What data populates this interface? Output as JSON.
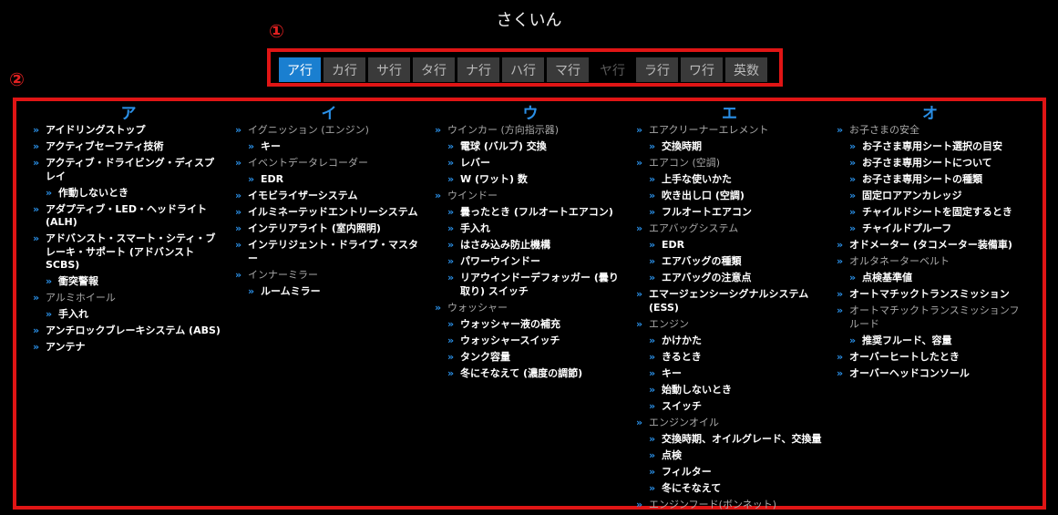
{
  "title": "さくいん",
  "markers": {
    "m1": "①",
    "m2": "②"
  },
  "colors": {
    "accent": "#1a7fd0",
    "frame": "#e01515",
    "heading": "#2a8fe6"
  },
  "tabs": [
    {
      "label": "ア行",
      "state": "active"
    },
    {
      "label": "カ行",
      "state": "normal"
    },
    {
      "label": "サ行",
      "state": "normal"
    },
    {
      "label": "タ行",
      "state": "normal"
    },
    {
      "label": "ナ行",
      "state": "normal"
    },
    {
      "label": "ハ行",
      "state": "normal"
    },
    {
      "label": "マ行",
      "state": "normal"
    },
    {
      "label": "ヤ行",
      "state": "disabled"
    },
    {
      "label": "ラ行",
      "state": "normal"
    },
    {
      "label": "ワ行",
      "state": "normal"
    },
    {
      "label": "英数",
      "state": "normal"
    }
  ],
  "columns": [
    {
      "heading": "ア",
      "entries": [
        {
          "text": "アイドリングストップ",
          "level": 0,
          "type": "link"
        },
        {
          "text": "アクティブセーフティ技術",
          "level": 0,
          "type": "link"
        },
        {
          "text": "アクティブ・ドライビング・ディスプレイ",
          "level": 0,
          "type": "link"
        },
        {
          "text": "作動しないとき",
          "level": 1,
          "type": "link"
        },
        {
          "text": "アダプティブ・LED・ヘッドライト (ALH)",
          "level": 0,
          "type": "link"
        },
        {
          "text": "アドバンスト・スマート・シティ・ブレーキ・サポート (アドバンストSCBS)",
          "level": 0,
          "type": "link"
        },
        {
          "text": "衝突警報",
          "level": 1,
          "type": "link"
        },
        {
          "text": "アルミホイール",
          "level": 0,
          "type": "cat"
        },
        {
          "text": "手入れ",
          "level": 1,
          "type": "link"
        },
        {
          "text": "アンチロックブレーキシステム (ABS)",
          "level": 0,
          "type": "link"
        },
        {
          "text": "アンテナ",
          "level": 0,
          "type": "link"
        }
      ]
    },
    {
      "heading": "イ",
      "entries": [
        {
          "text": "イグニッション (エンジン)",
          "level": 0,
          "type": "cat"
        },
        {
          "text": "キー",
          "level": 1,
          "type": "link"
        },
        {
          "text": "イベントデータレコーダー",
          "level": 0,
          "type": "cat"
        },
        {
          "text": "EDR",
          "level": 1,
          "type": "link"
        },
        {
          "text": "イモビライザーシステム",
          "level": 0,
          "type": "link"
        },
        {
          "text": "イルミネーテッドエントリーシステム",
          "level": 0,
          "type": "link"
        },
        {
          "text": "インテリアライト (室内照明)",
          "level": 0,
          "type": "link"
        },
        {
          "text": "インテリジェント・ドライブ・マスター",
          "level": 0,
          "type": "link"
        },
        {
          "text": "インナーミラー",
          "level": 0,
          "type": "cat"
        },
        {
          "text": "ルームミラー",
          "level": 1,
          "type": "link"
        }
      ]
    },
    {
      "heading": "ウ",
      "entries": [
        {
          "text": "ウインカー (方向指示器)",
          "level": 0,
          "type": "cat"
        },
        {
          "text": "電球 (バルブ) 交換",
          "level": 1,
          "type": "link"
        },
        {
          "text": "レバー",
          "level": 1,
          "type": "link"
        },
        {
          "text": "W (ワット) 数",
          "level": 1,
          "type": "link"
        },
        {
          "text": "ウインドー",
          "level": 0,
          "type": "cat"
        },
        {
          "text": "曇ったとき (フルオートエアコン)",
          "level": 1,
          "type": "link"
        },
        {
          "text": "手入れ",
          "level": 1,
          "type": "link"
        },
        {
          "text": "はさみ込み防止機構",
          "level": 1,
          "type": "link"
        },
        {
          "text": "パワーウインドー",
          "level": 1,
          "type": "link"
        },
        {
          "text": "リアウインドーデフォッガー (曇り取り) スイッチ",
          "level": 1,
          "type": "link"
        },
        {
          "text": "ウォッシャー",
          "level": 0,
          "type": "cat"
        },
        {
          "text": "ウォッシャー液の補充",
          "level": 1,
          "type": "link"
        },
        {
          "text": "ウォッシャースイッチ",
          "level": 1,
          "type": "link"
        },
        {
          "text": "タンク容量",
          "level": 1,
          "type": "link"
        },
        {
          "text": "冬にそなえて (濃度の調節)",
          "level": 1,
          "type": "link"
        }
      ]
    },
    {
      "heading": "エ",
      "entries": [
        {
          "text": "エアクリーナーエレメント",
          "level": 0,
          "type": "cat"
        },
        {
          "text": "交換時期",
          "level": 1,
          "type": "link"
        },
        {
          "text": "エアコン (空調)",
          "level": 0,
          "type": "cat"
        },
        {
          "text": "上手な使いかた",
          "level": 1,
          "type": "link"
        },
        {
          "text": "吹き出し口 (空調)",
          "level": 1,
          "type": "link"
        },
        {
          "text": "フルオートエアコン",
          "level": 1,
          "type": "link"
        },
        {
          "text": "エアバッグシステム",
          "level": 0,
          "type": "cat"
        },
        {
          "text": "EDR",
          "level": 1,
          "type": "link"
        },
        {
          "text": "エアバッグの種類",
          "level": 1,
          "type": "link"
        },
        {
          "text": "エアバッグの注意点",
          "level": 1,
          "type": "link"
        },
        {
          "text": "エマージェンシーシグナルシステム (ESS)",
          "level": 0,
          "type": "link"
        },
        {
          "text": "エンジン",
          "level": 0,
          "type": "cat"
        },
        {
          "text": "かけかた",
          "level": 1,
          "type": "link"
        },
        {
          "text": "きるとき",
          "level": 1,
          "type": "link"
        },
        {
          "text": "キー",
          "level": 1,
          "type": "link"
        },
        {
          "text": "始動しないとき",
          "level": 1,
          "type": "link"
        },
        {
          "text": "スイッチ",
          "level": 1,
          "type": "link"
        },
        {
          "text": "エンジンオイル",
          "level": 0,
          "type": "cat"
        },
        {
          "text": "交換時期、オイルグレード、交換量",
          "level": 1,
          "type": "link"
        },
        {
          "text": "点検",
          "level": 1,
          "type": "link"
        },
        {
          "text": "フィルター",
          "level": 1,
          "type": "link"
        },
        {
          "text": "冬にそなえて",
          "level": 1,
          "type": "link"
        },
        {
          "text": "エンジンフード(ボンネット)",
          "level": 0,
          "type": "cat"
        }
      ]
    },
    {
      "heading": "オ",
      "entries": [
        {
          "text": "お子さまの安全",
          "level": 0,
          "type": "cat"
        },
        {
          "text": "お子さま専用シート選択の目安",
          "level": 1,
          "type": "link"
        },
        {
          "text": "お子さま専用シートについて",
          "level": 1,
          "type": "link"
        },
        {
          "text": "お子さま専用シートの種類",
          "level": 1,
          "type": "link"
        },
        {
          "text": "固定ロアアンカレッジ",
          "level": 1,
          "type": "link"
        },
        {
          "text": "チャイルドシートを固定するとき",
          "level": 1,
          "type": "link"
        },
        {
          "text": "チャイルドプルーフ",
          "level": 1,
          "type": "link"
        },
        {
          "text": "オドメーター (タコメーター装備車)",
          "level": 0,
          "type": "link"
        },
        {
          "text": "オルタネーターベルト",
          "level": 0,
          "type": "cat"
        },
        {
          "text": "点検基準値",
          "level": 1,
          "type": "link"
        },
        {
          "text": "オートマチックトランスミッション",
          "level": 0,
          "type": "link"
        },
        {
          "text": "オートマチックトランスミッションフルード",
          "level": 0,
          "type": "cat"
        },
        {
          "text": "推奨フルード、容量",
          "level": 1,
          "type": "link"
        },
        {
          "text": "オーバーヒートしたとき",
          "level": 0,
          "type": "link"
        },
        {
          "text": "オーバーヘッドコンソール",
          "level": 0,
          "type": "link"
        }
      ]
    }
  ]
}
